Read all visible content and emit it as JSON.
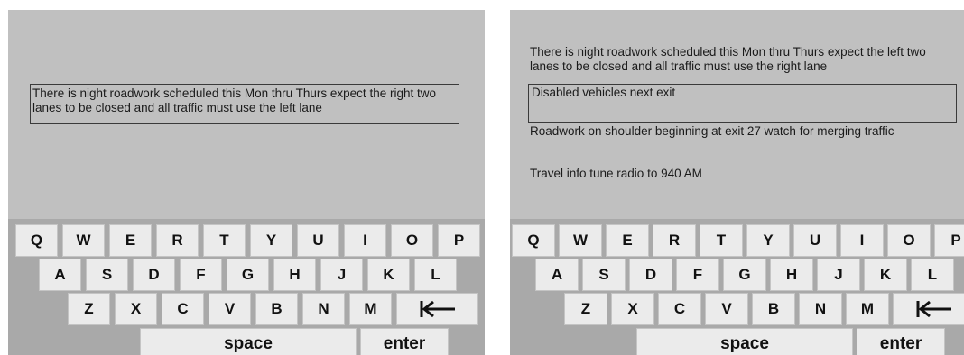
{
  "left_screen": {
    "message": "There is night roadwork scheduled this Mon thru Thurs expect the right two lanes to be closed and all traffic must use the left lane"
  },
  "right_screen": {
    "messages": [
      "There is night roadwork scheduled this Mon thru Thurs expect the left two lanes to be closed and all traffic must use the right lane",
      "Disabled vehicles next exit",
      "Roadwork on shoulder beginning at exit 27 watch for merging traffic",
      "Travel info tune radio to 940 AM"
    ]
  },
  "keyboard": {
    "row1": [
      "Q",
      "W",
      "E",
      "R",
      "T",
      "Y",
      "U",
      "I",
      "O",
      "P"
    ],
    "row2": [
      "A",
      "S",
      "D",
      "F",
      "G",
      "H",
      "J",
      "K",
      "L"
    ],
    "row3": [
      "Z",
      "X",
      "C",
      "V",
      "B",
      "N",
      "M"
    ],
    "backspace_icon": "backspace-arrow-icon",
    "space_label": "space",
    "enter_label": "enter"
  }
}
